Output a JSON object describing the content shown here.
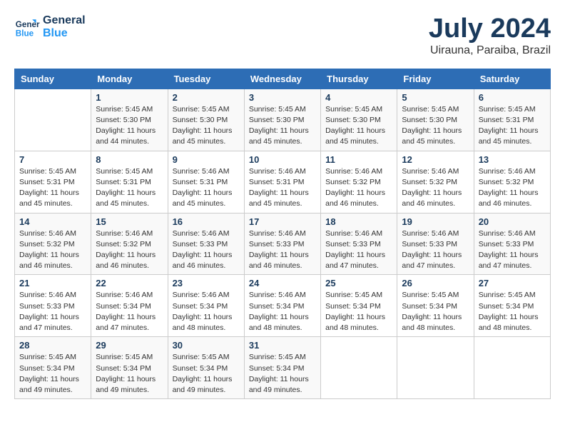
{
  "header": {
    "logo_line1": "General",
    "logo_line2": "Blue",
    "title": "July 2024",
    "location": "Uirauna, Paraiba, Brazil"
  },
  "columns": [
    "Sunday",
    "Monday",
    "Tuesday",
    "Wednesday",
    "Thursday",
    "Friday",
    "Saturday"
  ],
  "weeks": [
    [
      {
        "day": "",
        "info": ""
      },
      {
        "day": "1",
        "info": "Sunrise: 5:45 AM\nSunset: 5:30 PM\nDaylight: 11 hours\nand 44 minutes."
      },
      {
        "day": "2",
        "info": "Sunrise: 5:45 AM\nSunset: 5:30 PM\nDaylight: 11 hours\nand 45 minutes."
      },
      {
        "day": "3",
        "info": "Sunrise: 5:45 AM\nSunset: 5:30 PM\nDaylight: 11 hours\nand 45 minutes."
      },
      {
        "day": "4",
        "info": "Sunrise: 5:45 AM\nSunset: 5:30 PM\nDaylight: 11 hours\nand 45 minutes."
      },
      {
        "day": "5",
        "info": "Sunrise: 5:45 AM\nSunset: 5:30 PM\nDaylight: 11 hours\nand 45 minutes."
      },
      {
        "day": "6",
        "info": "Sunrise: 5:45 AM\nSunset: 5:31 PM\nDaylight: 11 hours\nand 45 minutes."
      }
    ],
    [
      {
        "day": "7",
        "info": "Sunrise: 5:45 AM\nSunset: 5:31 PM\nDaylight: 11 hours\nand 45 minutes."
      },
      {
        "day": "8",
        "info": "Sunrise: 5:45 AM\nSunset: 5:31 PM\nDaylight: 11 hours\nand 45 minutes."
      },
      {
        "day": "9",
        "info": "Sunrise: 5:46 AM\nSunset: 5:31 PM\nDaylight: 11 hours\nand 45 minutes."
      },
      {
        "day": "10",
        "info": "Sunrise: 5:46 AM\nSunset: 5:31 PM\nDaylight: 11 hours\nand 45 minutes."
      },
      {
        "day": "11",
        "info": "Sunrise: 5:46 AM\nSunset: 5:32 PM\nDaylight: 11 hours\nand 46 minutes."
      },
      {
        "day": "12",
        "info": "Sunrise: 5:46 AM\nSunset: 5:32 PM\nDaylight: 11 hours\nand 46 minutes."
      },
      {
        "day": "13",
        "info": "Sunrise: 5:46 AM\nSunset: 5:32 PM\nDaylight: 11 hours\nand 46 minutes."
      }
    ],
    [
      {
        "day": "14",
        "info": "Sunrise: 5:46 AM\nSunset: 5:32 PM\nDaylight: 11 hours\nand 46 minutes."
      },
      {
        "day": "15",
        "info": "Sunrise: 5:46 AM\nSunset: 5:32 PM\nDaylight: 11 hours\nand 46 minutes."
      },
      {
        "day": "16",
        "info": "Sunrise: 5:46 AM\nSunset: 5:33 PM\nDaylight: 11 hours\nand 46 minutes."
      },
      {
        "day": "17",
        "info": "Sunrise: 5:46 AM\nSunset: 5:33 PM\nDaylight: 11 hours\nand 46 minutes."
      },
      {
        "day": "18",
        "info": "Sunrise: 5:46 AM\nSunset: 5:33 PM\nDaylight: 11 hours\nand 47 minutes."
      },
      {
        "day": "19",
        "info": "Sunrise: 5:46 AM\nSunset: 5:33 PM\nDaylight: 11 hours\nand 47 minutes."
      },
      {
        "day": "20",
        "info": "Sunrise: 5:46 AM\nSunset: 5:33 PM\nDaylight: 11 hours\nand 47 minutes."
      }
    ],
    [
      {
        "day": "21",
        "info": "Sunrise: 5:46 AM\nSunset: 5:33 PM\nDaylight: 11 hours\nand 47 minutes."
      },
      {
        "day": "22",
        "info": "Sunrise: 5:46 AM\nSunset: 5:34 PM\nDaylight: 11 hours\nand 47 minutes."
      },
      {
        "day": "23",
        "info": "Sunrise: 5:46 AM\nSunset: 5:34 PM\nDaylight: 11 hours\nand 48 minutes."
      },
      {
        "day": "24",
        "info": "Sunrise: 5:46 AM\nSunset: 5:34 PM\nDaylight: 11 hours\nand 48 minutes."
      },
      {
        "day": "25",
        "info": "Sunrise: 5:45 AM\nSunset: 5:34 PM\nDaylight: 11 hours\nand 48 minutes."
      },
      {
        "day": "26",
        "info": "Sunrise: 5:45 AM\nSunset: 5:34 PM\nDaylight: 11 hours\nand 48 minutes."
      },
      {
        "day": "27",
        "info": "Sunrise: 5:45 AM\nSunset: 5:34 PM\nDaylight: 11 hours\nand 48 minutes."
      }
    ],
    [
      {
        "day": "28",
        "info": "Sunrise: 5:45 AM\nSunset: 5:34 PM\nDaylight: 11 hours\nand 49 minutes."
      },
      {
        "day": "29",
        "info": "Sunrise: 5:45 AM\nSunset: 5:34 PM\nDaylight: 11 hours\nand 49 minutes."
      },
      {
        "day": "30",
        "info": "Sunrise: 5:45 AM\nSunset: 5:34 PM\nDaylight: 11 hours\nand 49 minutes."
      },
      {
        "day": "31",
        "info": "Sunrise: 5:45 AM\nSunset: 5:34 PM\nDaylight: 11 hours\nand 49 minutes."
      },
      {
        "day": "",
        "info": ""
      },
      {
        "day": "",
        "info": ""
      },
      {
        "day": "",
        "info": ""
      }
    ]
  ]
}
